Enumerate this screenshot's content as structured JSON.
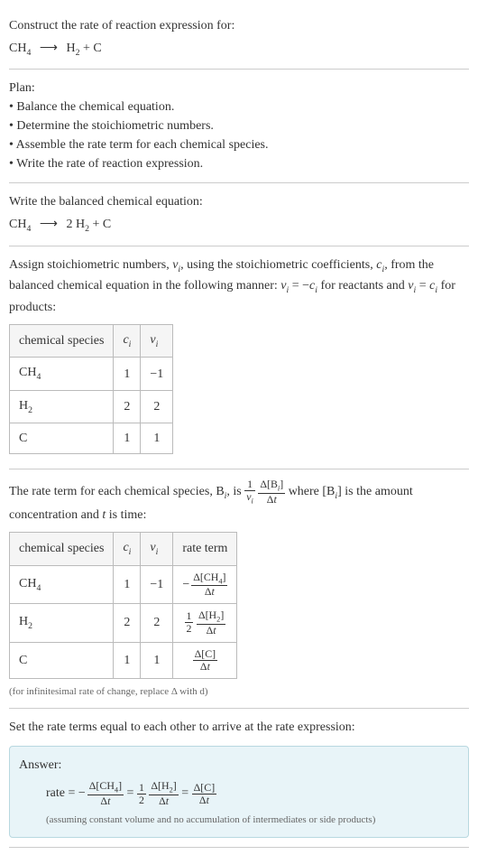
{
  "intro": {
    "title": "Construct the rate of reaction expression for:",
    "reaction": "CH₄ ⟶ H₂ + C",
    "reaction_html": "CH<sub>4</sub> ⟶ H<sub>2</sub> + C"
  },
  "plan": {
    "title": "Plan:",
    "items": [
      "• Balance the chemical equation.",
      "• Determine the stoichiometric numbers.",
      "• Assemble the rate term for each chemical species.",
      "• Write the rate of reaction expression."
    ]
  },
  "balanced": {
    "title": "Write the balanced chemical equation:",
    "equation": "CH₄ ⟶ 2 H₂ + C"
  },
  "stoich": {
    "title_part1": "Assign stoichiometric numbers, ",
    "title_part2": ", using the stoichiometric coefficients, ",
    "title_part3": ", from the balanced chemical equation in the following manner: ",
    "title_part4": " for reactants and ",
    "title_part5": " for products:",
    "table": {
      "headers": [
        "chemical species",
        "cᵢ",
        "νᵢ"
      ],
      "rows": [
        {
          "species": "CH₄",
          "c": "1",
          "v": "−1"
        },
        {
          "species": "H₂",
          "c": "2",
          "v": "2"
        },
        {
          "species": "C",
          "c": "1",
          "v": "1"
        }
      ]
    }
  },
  "rateterm": {
    "title_part1": "The rate term for each chemical species, B",
    "title_part2": ", is ",
    "title_part3": " where [B",
    "title_part4": "] is the amount concentration and ",
    "title_part5": " is time:",
    "table": {
      "headers": [
        "chemical species",
        "cᵢ",
        "νᵢ",
        "rate term"
      ],
      "rows": [
        {
          "species": "CH₄",
          "c": "1",
          "v": "−1"
        },
        {
          "species": "H₂",
          "c": "2",
          "v": "2"
        },
        {
          "species": "C",
          "c": "1",
          "v": "1"
        }
      ]
    },
    "note": "(for infinitesimal rate of change, replace Δ with d)"
  },
  "final": {
    "title": "Set the rate terms equal to each other to arrive at the rate expression:",
    "answer_label": "Answer:",
    "rate_prefix": "rate = ",
    "note": "(assuming constant volume and no accumulation of intermediates or side products)"
  }
}
